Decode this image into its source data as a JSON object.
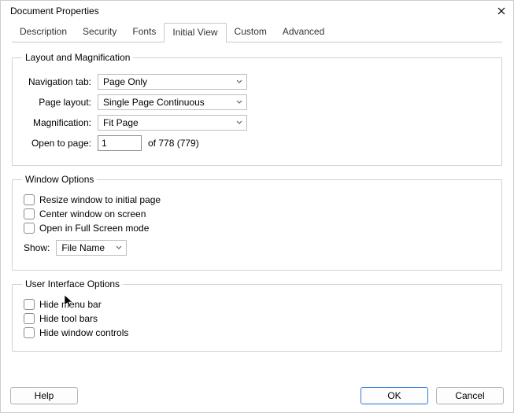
{
  "window": {
    "title": "Document Properties"
  },
  "tabs": {
    "description": "Description",
    "security": "Security",
    "fonts": "Fonts",
    "initial_view": "Initial View",
    "custom": "Custom",
    "advanced": "Advanced"
  },
  "layout_mag": {
    "legend": "Layout and Magnification",
    "nav_tab_label": "Navigation tab:",
    "nav_tab_value": "Page Only",
    "page_layout_label": "Page layout:",
    "page_layout_value": "Single Page Continuous",
    "magnification_label": "Magnification:",
    "magnification_value": "Fit Page",
    "open_to_page_label": "Open to page:",
    "open_to_page_value": "1",
    "open_to_page_suffix": "of 778 (779)"
  },
  "window_options": {
    "legend": "Window Options",
    "resize": "Resize window to initial page",
    "center": "Center window on screen",
    "fullscreen": "Open in Full Screen mode",
    "show_label": "Show:",
    "show_value": "File Name"
  },
  "ui_options": {
    "legend": "User Interface Options",
    "hide_menu": "Hide menu bar",
    "hide_tool": "Hide tool bars",
    "hide_ctrl": "Hide window controls"
  },
  "buttons": {
    "help": "Help",
    "ok": "OK",
    "cancel": "Cancel"
  }
}
